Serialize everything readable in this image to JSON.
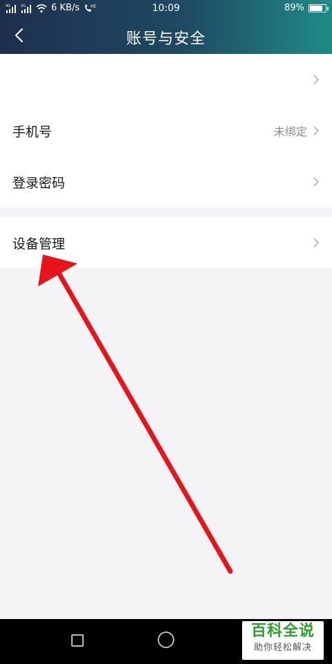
{
  "status_bar": {
    "network_speed": "6 KB/s",
    "time": "10:09",
    "battery_percent": "89%",
    "battery_level": 0.89,
    "icons": [
      "signal-4g-icon",
      "signal-2g-icon",
      "wifi-icon",
      "hd-call-icon"
    ]
  },
  "header": {
    "title": "账号与安全",
    "back_icon": "chevron-left-icon"
  },
  "sections": [
    {
      "rows": [
        {
          "label": "",
          "value": ""
        },
        {
          "label": "手机号",
          "value": "未绑定"
        },
        {
          "label": "登录密码",
          "value": ""
        }
      ]
    },
    {
      "rows": [
        {
          "label": "设备管理",
          "value": ""
        }
      ]
    }
  ],
  "nav_bar": {
    "buttons": [
      "recent-apps-button",
      "home-button"
    ]
  },
  "watermark": {
    "title": "百科全说",
    "subtitle": "助你轻松解决"
  },
  "annotation": {
    "type": "red-arrow",
    "color": "#e8141b",
    "points_to": "设备管理"
  }
}
